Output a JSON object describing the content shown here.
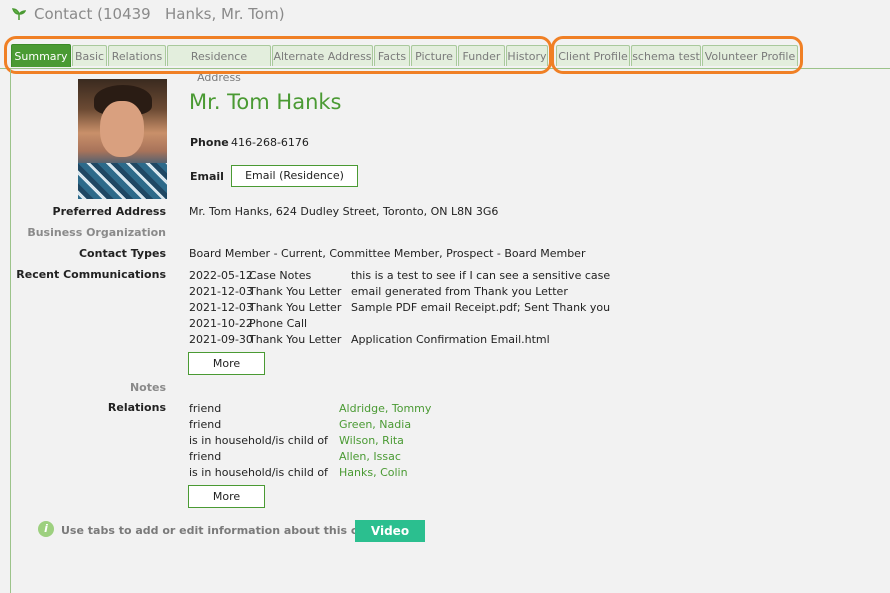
{
  "window": {
    "title": "Contact (10439   Hanks, Mr. Tom)",
    "icon": "sprout-icon"
  },
  "tabs": [
    {
      "label": "Summary",
      "active": true
    },
    {
      "label": "Basic"
    },
    {
      "label": "Relations"
    },
    {
      "label": "Residence Address"
    },
    {
      "label": "Alternate Address"
    },
    {
      "label": "Facts"
    },
    {
      "label": "Picture"
    },
    {
      "label": "Funder"
    },
    {
      "label": "History"
    },
    {
      "label": "Client Profile"
    },
    {
      "label": "schema test"
    },
    {
      "label": "Volunteer Profile"
    }
  ],
  "contact": {
    "name": "Mr. Tom Hanks",
    "phone_label": "Phone",
    "phone": "416-268-6176",
    "email_label": "Email",
    "email_button": "Email (Residence)",
    "preferred_address_label": "Preferred Address",
    "preferred_address": "Mr. Tom Hanks, 624 Dudley Street, Toronto, ON  L8N 3G6",
    "business_org_label": "Business Organization",
    "contact_types_label": "Contact Types",
    "contact_types": "Board Member - Current, Committee Member, Prospect - Board Member"
  },
  "communications": {
    "label": "Recent Communications",
    "items": [
      {
        "date": "2022-05-12",
        "type": "Case Notes",
        "subject": "this is a test to see if I can see a sensitive case"
      },
      {
        "date": "2021-12-03",
        "type": "Thank You Letter",
        "subject": "email generated from Thank you Letter"
      },
      {
        "date": "2021-12-03",
        "type": "Thank You Letter",
        "subject": "Sample PDF email Receipt.pdf; Sent Thank you"
      },
      {
        "date": "2021-10-22",
        "type": "Phone Call",
        "subject": ""
      },
      {
        "date": "2021-09-30",
        "type": "Thank You Letter",
        "subject": "Application Confirmation Email.html"
      }
    ],
    "more": "More"
  },
  "notes_label": "Notes",
  "relations": {
    "label": "Relations",
    "items": [
      {
        "relation": "friend",
        "name": "Aldridge, Tommy"
      },
      {
        "relation": "friend",
        "name": "Green, Nadia"
      },
      {
        "relation": "is in household/is child of",
        "name": "Wilson, Rita"
      },
      {
        "relation": "friend",
        "name": "Allen, Issac"
      },
      {
        "relation": "is in household/is child of",
        "name": "Hanks, Colin"
      }
    ],
    "more": "More"
  },
  "footer": {
    "info_icon": "info-icon",
    "hint": "Use tabs to add or edit information about this contact.",
    "video": "Video"
  },
  "colors": {
    "accent": "#4a9a33",
    "highlight": "#f08025",
    "video": "#2bbf8f"
  }
}
